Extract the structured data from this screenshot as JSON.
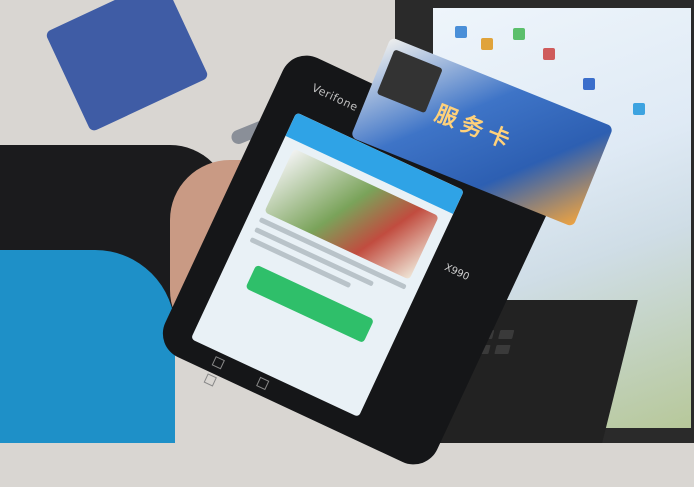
{
  "scene": {
    "device": {
      "brand": "Verifone",
      "model": "X990",
      "screen": {
        "header": "",
        "button_label": ""
      }
    },
    "card": {
      "title": "服务卡",
      "subtitle": ""
    }
  },
  "palette": {
    "app_header": "#2fa3e6",
    "app_button": "#2fbf6a",
    "jacket": "#1e90c8",
    "card_blue": "#2d5fb2"
  }
}
